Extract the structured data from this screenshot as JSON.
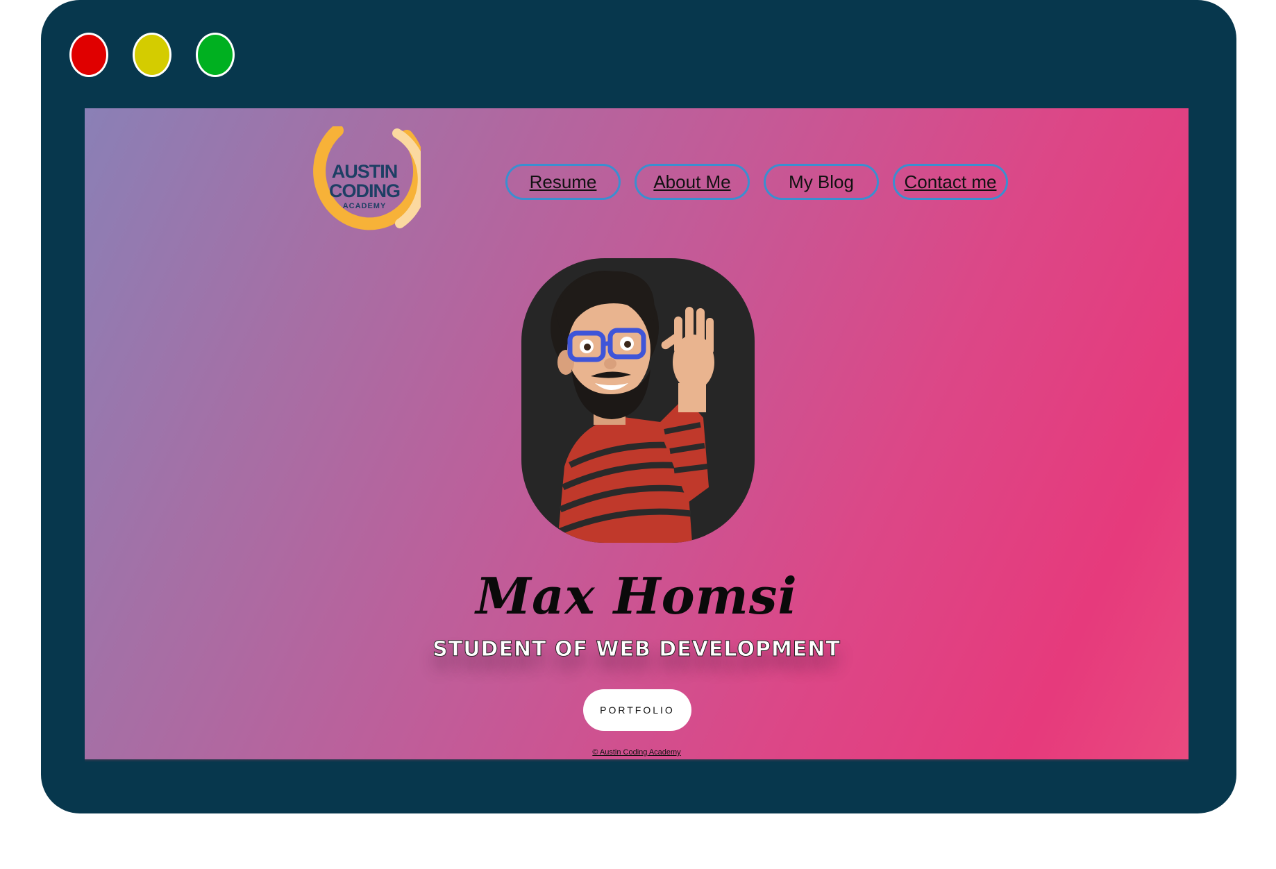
{
  "window": {
    "controls": {
      "close_color": "#e00000",
      "minimize_color": "#d4cc00",
      "zoom_color": "#00b020"
    },
    "frame_color": "#07374d"
  },
  "logo": {
    "line1": "AUSTIN",
    "line2": "CODING",
    "line3": "ACADEMY",
    "ring_color": "#f7b238"
  },
  "nav": {
    "items": [
      {
        "label": "Resume"
      },
      {
        "label": "About Me"
      },
      {
        "label": "My Blog"
      },
      {
        "label": "Contact me"
      }
    ],
    "border_color": "#3a8fd0"
  },
  "hero": {
    "avatar": "memoji-waving-avatar",
    "name": "Max Homsi",
    "subtitle": "STUDENT OF WEB DEVELOPMENT",
    "button_label": "PORTFOLIO"
  },
  "footer": {
    "text": "© Austin Coding Academy"
  },
  "colors": {
    "gradient_start": "#8a80b6",
    "gradient_end": "#e63a7c"
  }
}
